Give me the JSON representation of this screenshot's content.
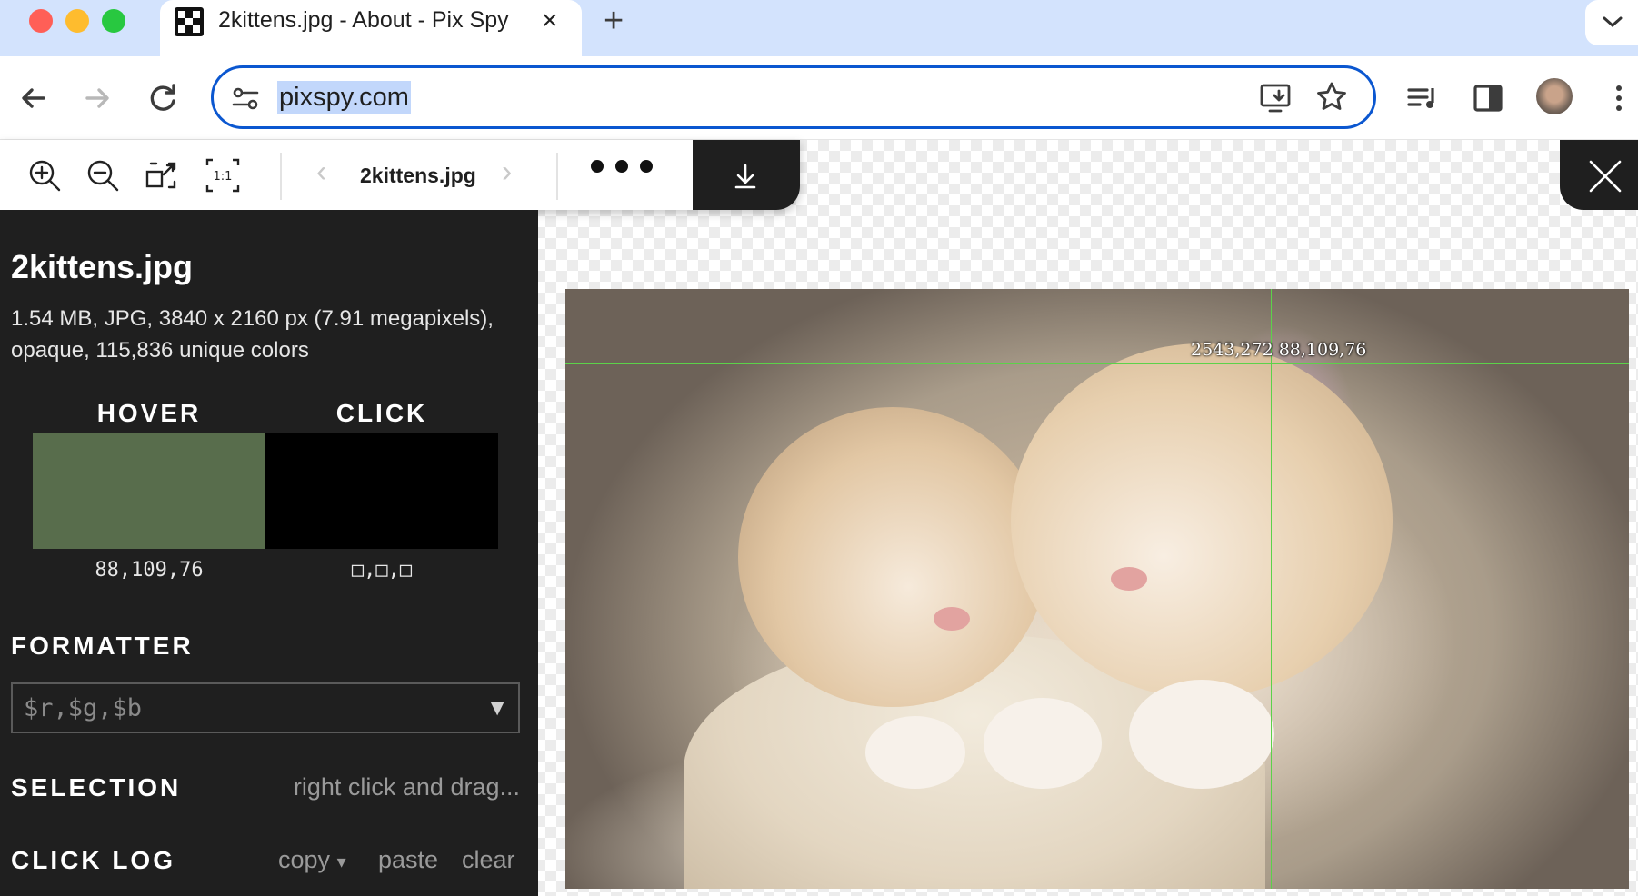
{
  "browser": {
    "tab_title": "2kittens.jpg - About - Pix Spy",
    "url": "pixspy.com",
    "icons": [
      "back-icon",
      "forward-icon",
      "reload-icon",
      "site-settings-icon",
      "install-app-icon",
      "bookmark-star-icon",
      "media-control-icon",
      "side-panel-icon",
      "profile-avatar",
      "more-menu-icon"
    ]
  },
  "app_toolbar": {
    "filename": "2kittens.jpg",
    "prev_glyph": "‹",
    "next_glyph": "›",
    "icons": [
      "zoom-in-icon",
      "zoom-out-icon",
      "fit-to-screen-icon",
      "actual-size-icon",
      "more-icon",
      "download-icon",
      "close-icon"
    ]
  },
  "sidebar": {
    "title": "2kittens.jpg",
    "meta": "1.54 MB, JPG, 3840 x 2160 px (7.91 megapixels), opaque, 115,836 unique colors",
    "hover": {
      "label": "HOVER",
      "value": "88,109,76",
      "color": "#586d4c"
    },
    "click": {
      "label": "CLICK",
      "value": "□,□,□",
      "color": "#000000"
    },
    "formatter": {
      "label": "FORMATTER",
      "value": "$r,$g,$b",
      "arrow": "▼"
    },
    "selection": {
      "label": "SELECTION",
      "hint": "right click and drag..."
    },
    "click_log": {
      "label": "CLICK LOG",
      "copy": "copy",
      "copy_arrow": "▾",
      "paste": "paste",
      "clear": "clear"
    }
  },
  "canvas": {
    "image_alt": "two sleeping kittens",
    "readout": "2543,272 88,109,76"
  },
  "colors": {
    "tabstrip": "#d3e3fd",
    "omnibox_border": "#0b57d0",
    "sidebar_bg": "#1f1f1f",
    "crosshair": "#5cd24a"
  }
}
